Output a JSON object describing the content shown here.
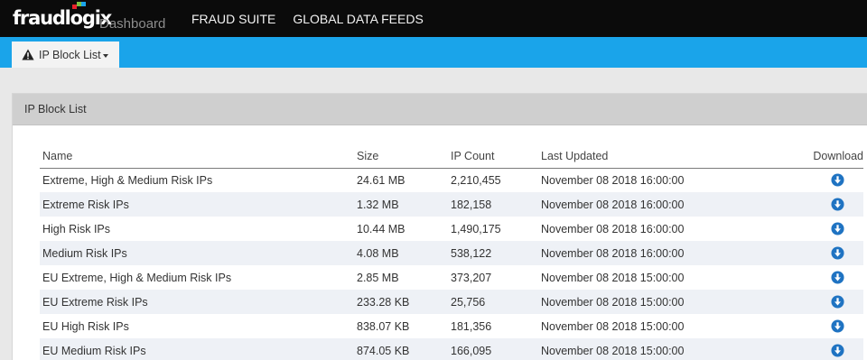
{
  "brand": {
    "logo_text": "fraudlogix",
    "subtitle": "Dashboard",
    "dot_colors": [
      "#e8202a",
      "#7ac143",
      "#1aa4ea"
    ]
  },
  "top_nav": [
    {
      "label": "FRAUD SUITE"
    },
    {
      "label": "GLOBAL DATA FEEDS"
    }
  ],
  "sub_nav": {
    "active_tab": {
      "label": "IP Block List",
      "icon": "warning-icon"
    }
  },
  "panel": {
    "title": "IP Block List"
  },
  "table": {
    "columns": [
      "Name",
      "Size",
      "IP Count",
      "Last Updated",
      "Download"
    ],
    "rows": [
      {
        "name": "Extreme, High & Medium Risk IPs",
        "size": "24.61 MB",
        "ip_count": "2,210,455",
        "last_updated": "November 08 2018 16:00:00"
      },
      {
        "name": "Extreme Risk IPs",
        "size": "1.32 MB",
        "ip_count": "182,158",
        "last_updated": "November 08 2018 16:00:00"
      },
      {
        "name": "High Risk IPs",
        "size": "10.44 MB",
        "ip_count": "1,490,175",
        "last_updated": "November 08 2018 16:00:00"
      },
      {
        "name": "Medium Risk IPs",
        "size": "4.08 MB",
        "ip_count": "538,122",
        "last_updated": "November 08 2018 16:00:00"
      },
      {
        "name": "EU Extreme, High & Medium Risk IPs",
        "size": "2.85 MB",
        "ip_count": "373,207",
        "last_updated": "November 08 2018 15:00:00"
      },
      {
        "name": "EU Extreme Risk IPs",
        "size": "233.28 KB",
        "ip_count": "25,756",
        "last_updated": "November 08 2018 15:00:00"
      },
      {
        "name": "EU High Risk IPs",
        "size": "838.07 KB",
        "ip_count": "181,356",
        "last_updated": "November 08 2018 15:00:00"
      },
      {
        "name": "EU Medium Risk IPs",
        "size": "874.05 KB",
        "ip_count": "166,095",
        "last_updated": "November 08 2018 15:00:00"
      }
    ],
    "download_icon": "download-circle-icon"
  },
  "colors": {
    "topbar": "#0b0b0b",
    "accent": "#1aa4ea",
    "download_icon": "#1f73c2"
  }
}
